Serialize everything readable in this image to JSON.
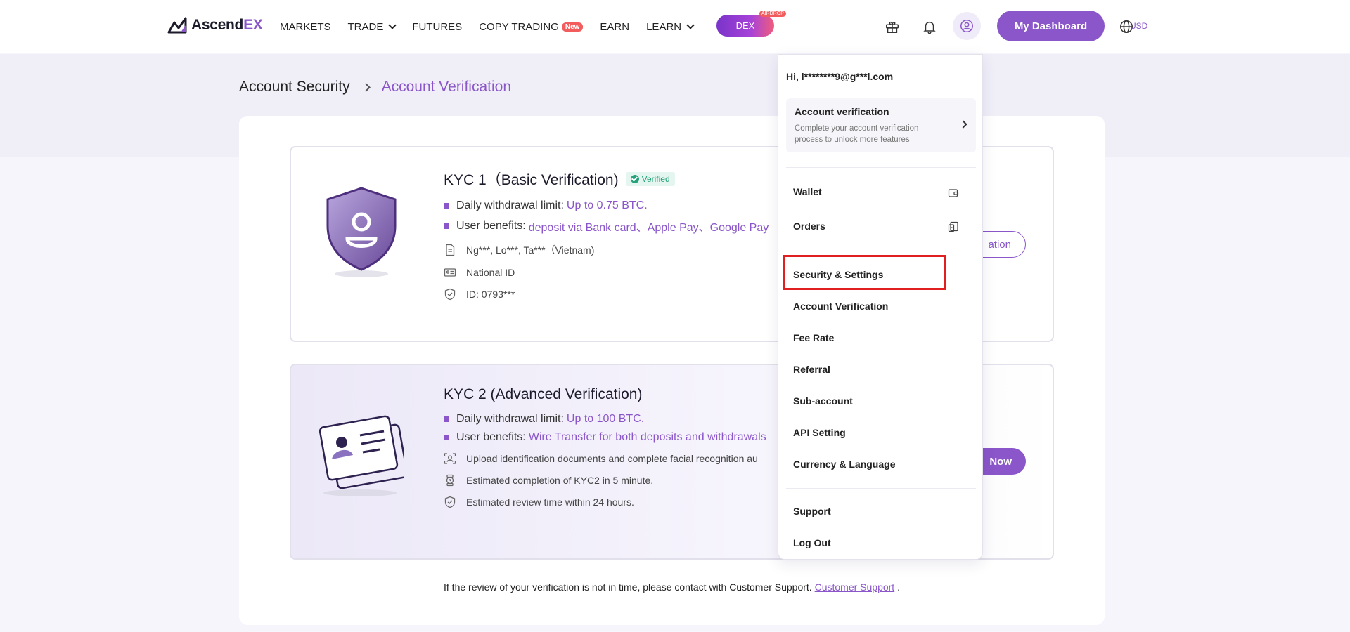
{
  "nav": {
    "logo_prefix": "Ascend",
    "logo_suffix": "EX",
    "menu": [
      {
        "label": "MARKETS"
      },
      {
        "label": "TRADE"
      },
      {
        "label": "FUTURES"
      },
      {
        "label": "COPY TRADING"
      },
      {
        "label": "EARN"
      },
      {
        "label": "LEARN"
      }
    ],
    "new_badge": "New",
    "dex_label": "DEX",
    "dex_tag": "AIRDROP",
    "dashboard_label": "My Dashboard",
    "currency": "USD"
  },
  "breadcrumb": {
    "parent": "Account Security",
    "current": "Account Verification"
  },
  "kyc1": {
    "title": "KYC 1（Basic Verification)",
    "status": "Verified",
    "limit_label": "Daily withdrawal limit:",
    "limit_value": "Up to 0.75 BTC.",
    "benefits_label": "User benefits:",
    "benefits_value": "deposit via Bank card、Apple Pay、Google Pay",
    "name": "Ng***, Lo***, Ta***（Vietnam)",
    "doc_type": "National ID",
    "id": "ID: 0793***",
    "action_label": "ation"
  },
  "kyc2": {
    "title": "KYC 2 (Advanced Verification)",
    "limit_label": "Daily withdrawal limit:",
    "limit_value": "Up to 100 BTC.",
    "benefits_label": "User benefits:",
    "benefits_value": "Wire Transfer for both deposits and withdrawals",
    "detail1": "Upload identification documents and complete facial recognition au",
    "detail2": "Estimated completion of KYC2 in 5 minute.",
    "detail3": "Estimated review time within 24 hours.",
    "action_label": "Now"
  },
  "footer": {
    "note": "If the review of your verification is not in time, please contact with Customer Support.",
    "link": "Customer Support",
    "trailing": "."
  },
  "dropdown": {
    "greeting": "Hi, l********9@g***l.com",
    "verify_title": "Account verification",
    "verify_desc": "Complete your account verification process to unlock more features",
    "items": [
      {
        "label": "Wallet"
      },
      {
        "label": "Orders"
      },
      {
        "label": "Security & Settings"
      },
      {
        "label": "Account Verification"
      },
      {
        "label": "Fee Rate"
      },
      {
        "label": "Referral"
      },
      {
        "label": "Sub-account"
      },
      {
        "label": "API Setting"
      },
      {
        "label": "Currency & Language"
      },
      {
        "label": "Support"
      },
      {
        "label": "Log Out"
      }
    ]
  },
  "colors": {
    "accent": "#8a56c9",
    "verified": "#26a17b",
    "highlight": "#e02020"
  }
}
